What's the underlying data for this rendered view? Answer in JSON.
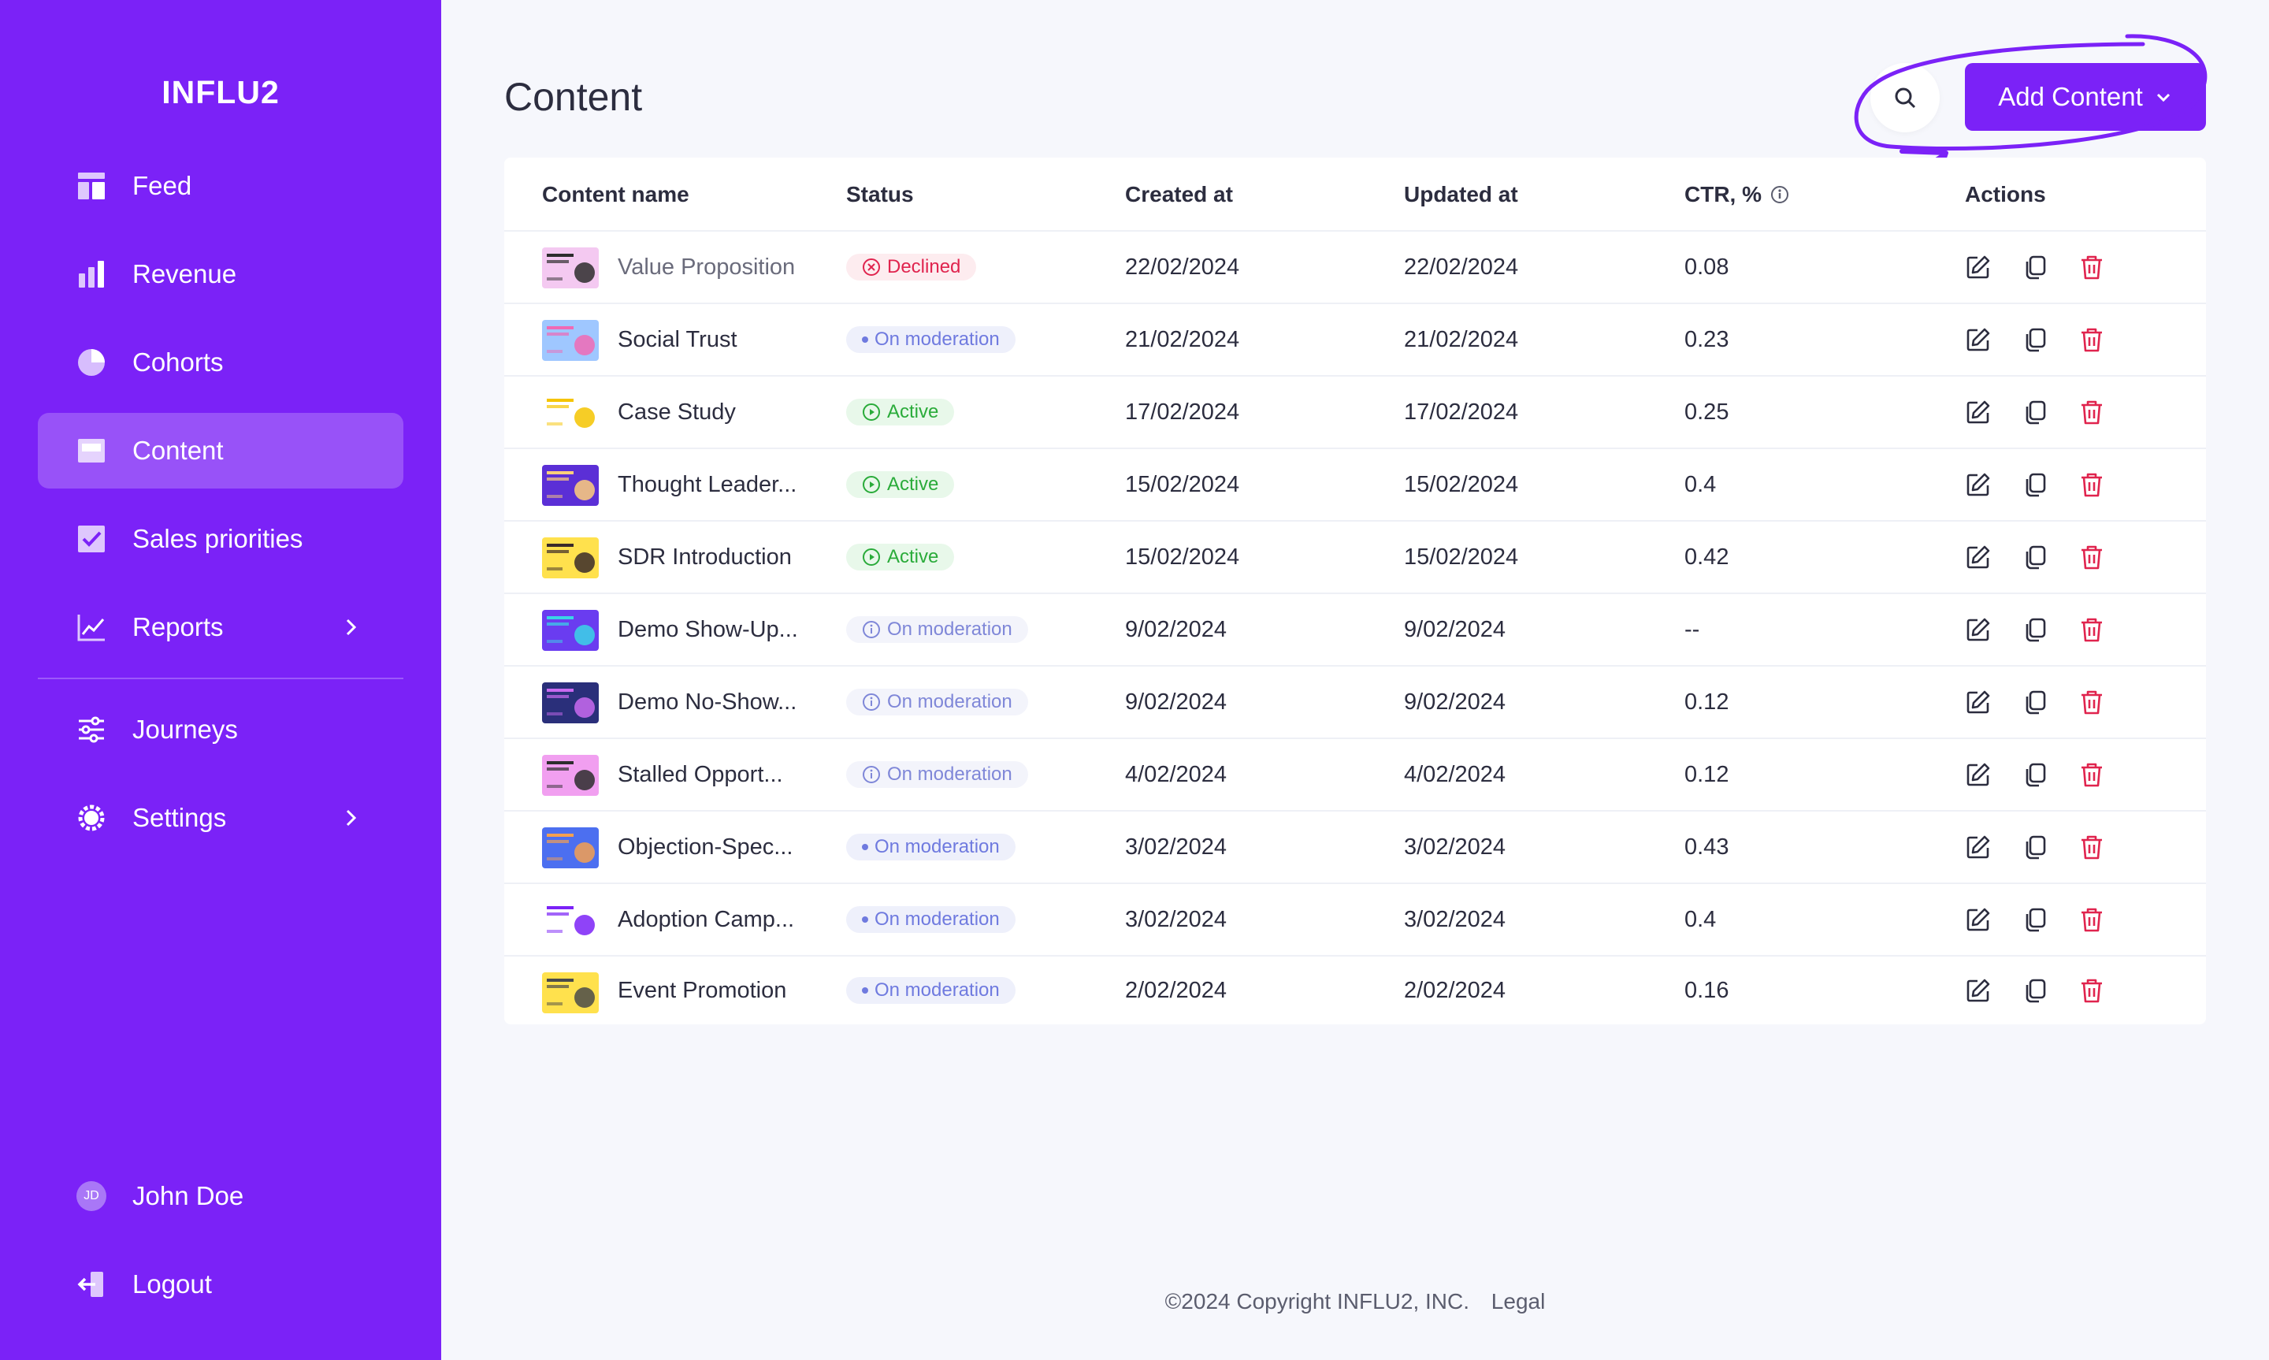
{
  "brand": "INFLU2",
  "sidebar": {
    "items": [
      {
        "label": "Feed",
        "icon": "feed-icon"
      },
      {
        "label": "Revenue",
        "icon": "bar-chart-icon"
      },
      {
        "label": "Cohorts",
        "icon": "pie-chart-icon"
      },
      {
        "label": "Content",
        "icon": "content-icon",
        "active": true
      },
      {
        "label": "Sales priorities",
        "icon": "checkbox-icon"
      },
      {
        "label": "Reports",
        "icon": "line-chart-icon",
        "has_submenu": true
      },
      {
        "label": "Journeys",
        "icon": "sliders-icon"
      },
      {
        "label": "Settings",
        "icon": "gear-icon",
        "has_submenu": true
      }
    ],
    "user": {
      "initials": "JD",
      "name": "John Doe"
    },
    "logout": "Logout"
  },
  "page": {
    "title": "Content",
    "add_button": "Add Content"
  },
  "table": {
    "headers": {
      "name": "Content name",
      "status": "Status",
      "created": "Created at",
      "updated": "Updated at",
      "ctr": "CTR, %",
      "actions": "Actions"
    },
    "rows": [
      {
        "name": "Value Proposition",
        "status": "Declined",
        "status_style": "declined",
        "created": "22/02/2024",
        "updated": "22/02/2024",
        "ctr": "0.08"
      },
      {
        "name": "Social Trust",
        "status": "On moderation",
        "status_style": "mod-dot",
        "created": "21/02/2024",
        "updated": "21/02/2024",
        "ctr": "0.23"
      },
      {
        "name": "Case Study",
        "status": "Active",
        "status_style": "active",
        "created": "17/02/2024",
        "updated": "17/02/2024",
        "ctr": "0.25"
      },
      {
        "name": "Thought Leader...",
        "status": "Active",
        "status_style": "active",
        "created": "15/02/2024",
        "updated": "15/02/2024",
        "ctr": "0.4"
      },
      {
        "name": "SDR Introduction",
        "status": "Active",
        "status_style": "active",
        "created": "15/02/2024",
        "updated": "15/02/2024",
        "ctr": "0.42"
      },
      {
        "name": "Demo Show-Up...",
        "status": "On moderation",
        "status_style": "mod-info",
        "created": "9/02/2024",
        "updated": "9/02/2024",
        "ctr": "--"
      },
      {
        "name": "Demo No-Show...",
        "status": "On moderation",
        "status_style": "mod-info",
        "created": "9/02/2024",
        "updated": "9/02/2024",
        "ctr": "0.12"
      },
      {
        "name": "Stalled Opport...",
        "status": "On moderation",
        "status_style": "mod-info",
        "created": "4/02/2024",
        "updated": "4/02/2024",
        "ctr": "0.12"
      },
      {
        "name": "Objection-Spec...",
        "status": "On moderation",
        "status_style": "mod-dot",
        "created": "3/02/2024",
        "updated": "3/02/2024",
        "ctr": "0.43"
      },
      {
        "name": "Adoption Camp...",
        "status": "On moderation",
        "status_style": "mod-dot",
        "created": "3/02/2024",
        "updated": "3/02/2024",
        "ctr": "0.4"
      },
      {
        "name": "Event Promotion",
        "status": "On moderation",
        "status_style": "mod-dot",
        "created": "2/02/2024",
        "updated": "2/02/2024",
        "ctr": "0.16"
      }
    ]
  },
  "footer": {
    "copyright": "©2024 Copyright INFLU2, INC.",
    "legal": "Legal"
  },
  "colors": {
    "brand": "#7b22f7",
    "declined": "#e0244e",
    "active": "#2aab3a",
    "moderation": "#6f7adf",
    "delete": "#e0244e"
  }
}
